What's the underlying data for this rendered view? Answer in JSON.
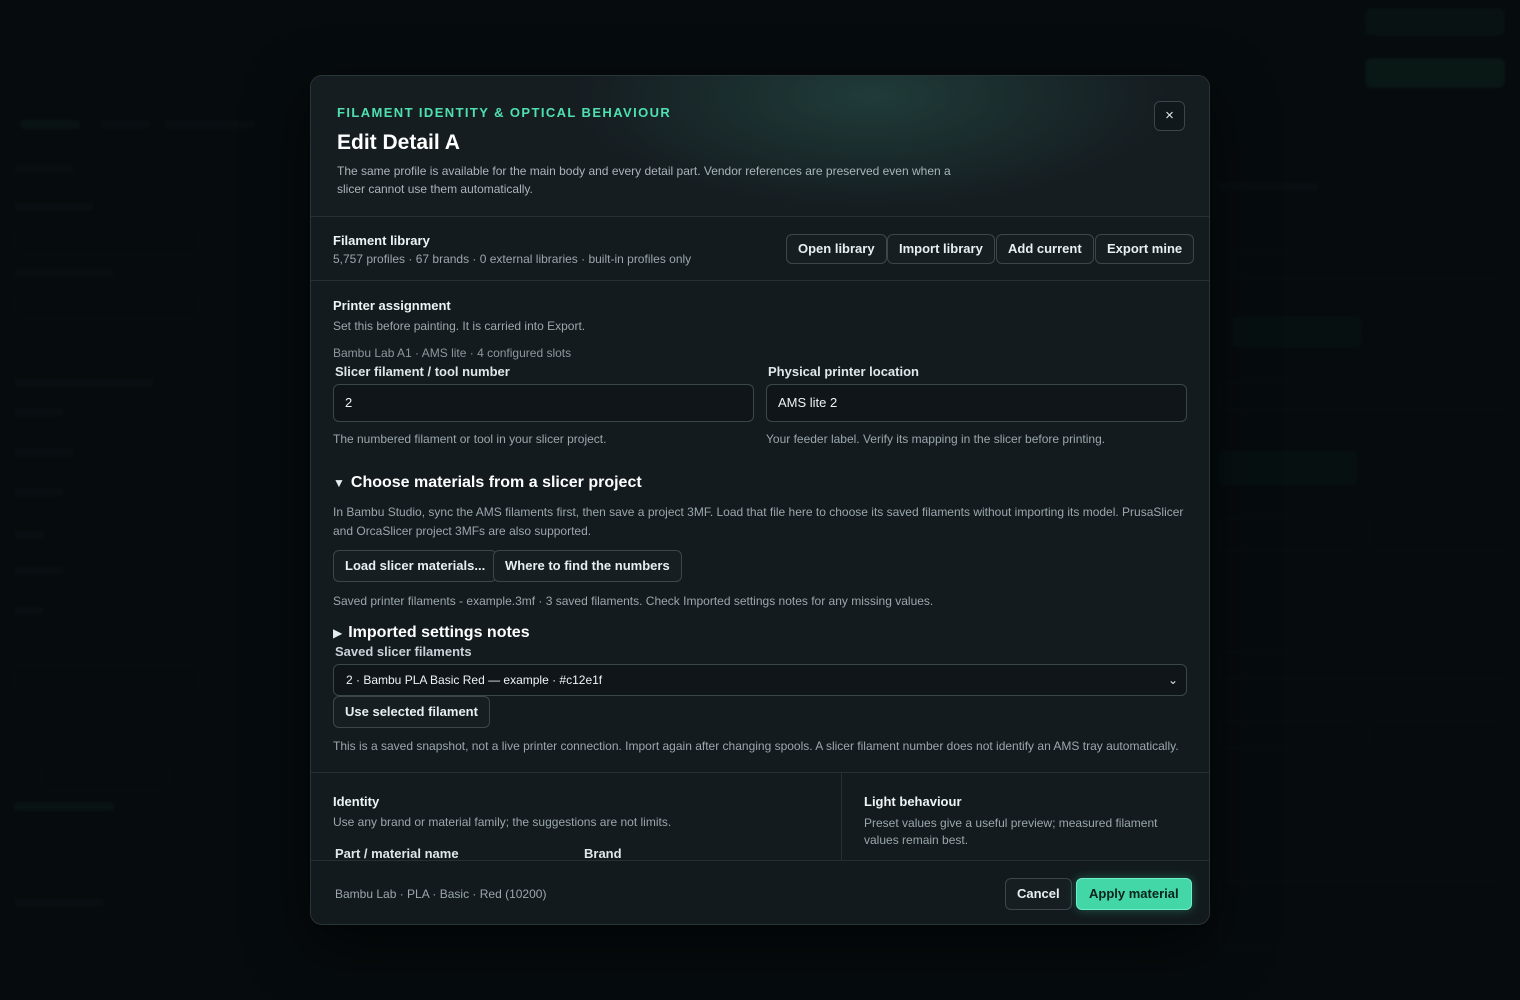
{
  "modal": {
    "eyebrow": "FILAMENT IDENTITY & OPTICAL BEHAVIOUR",
    "title": "Edit Detail A",
    "description": "The same profile is available for the main body and every detail part. Vendor references are preserved even when a slicer cannot use them automatically.",
    "close_label": "×"
  },
  "library": {
    "title": "Filament library",
    "summary": "5,757 profiles · 67 brands · 0 external libraries · built-in profiles only",
    "buttons": {
      "open": "Open library",
      "import": "Import library",
      "add_current": "Add current",
      "export_mine": "Export mine"
    }
  },
  "printer": {
    "title": "Printer assignment",
    "subtitle": "Set this before painting. It is carried into Export.",
    "printer_info": "Bambu Lab A1 · AMS lite · 4 configured slots",
    "tool_label": "Slicer filament / tool number",
    "tool_value": "2",
    "tool_help": "The numbered filament or tool in your slicer project.",
    "location_label": "Physical printer location",
    "location_value": "AMS lite 2",
    "location_help": "Your feeder label. Verify its mapping in the slicer before printing."
  },
  "slicer_project": {
    "heading": "Choose materials from a slicer project",
    "description": "In Bambu Studio, sync the AMS filaments first, then save a project 3MF. Load that file here to choose its saved filaments without importing its model. PrusaSlicer and OrcaSlicer project 3MFs are also supported.",
    "load_button": "Load slicer materials...",
    "where_button": "Where to find the numbers",
    "status": "Saved printer filaments - example.3mf · 3 saved filaments. Check Imported settings notes for any missing values.",
    "notes_heading": "Imported settings notes",
    "select_label": "Saved slicer filaments",
    "selected_option": "2 · Bambu PLA Basic Red — example · #c12e1f",
    "use_button": "Use selected filament",
    "disclaimer": "This is a saved snapshot, not a live printer connection. Import again after changing spools. A slicer filament number does not identify an AMS tray automatically."
  },
  "identity": {
    "title": "Identity",
    "subtitle": "Use any brand or material family; the suggestions are not limits.",
    "name_label": "Part / material name",
    "brand_label": "Brand"
  },
  "light": {
    "title": "Light behaviour",
    "subtitle": "Preset values give a useful preview; measured filament values remain best."
  },
  "footer": {
    "summary": "Bambu Lab · PLA · Basic · Red (10200)",
    "cancel": "Cancel",
    "apply": "Apply material"
  },
  "colors": {
    "accent": "#43d6a6",
    "eyebrow": "#4fe0b0",
    "background": "#0a1013",
    "modal": "#141b1f"
  }
}
